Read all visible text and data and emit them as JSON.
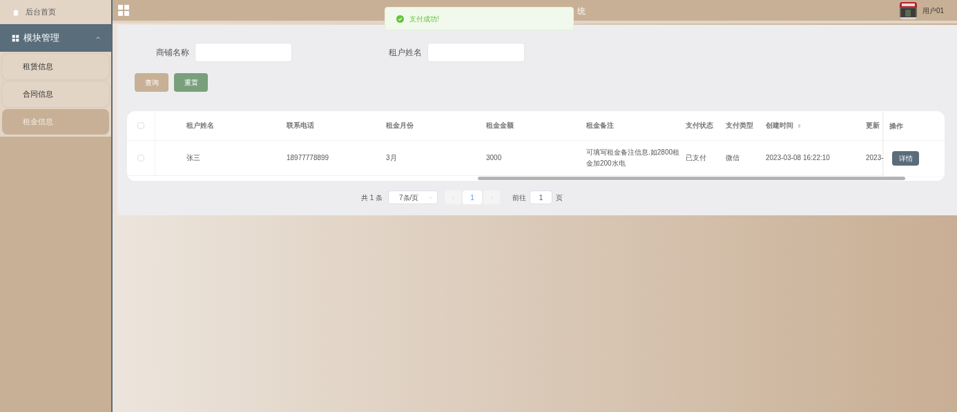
{
  "sidebar": {
    "home": {
      "label": "后台首页"
    },
    "group": {
      "label": "模块管理",
      "expanded": true,
      "items": [
        {
          "label": "租赁信息",
          "selected": false
        },
        {
          "label": "合同信息",
          "selected": false
        },
        {
          "label": "租金信息",
          "selected": true
        }
      ]
    }
  },
  "header": {
    "title": "统",
    "user": "用户01"
  },
  "toast": {
    "message": "支付成功!"
  },
  "filters": [
    {
      "label": "商铺名称"
    },
    {
      "label": "租户姓名"
    }
  ],
  "buttons": [
    {
      "label": "查询",
      "kind": "search"
    },
    {
      "label": "重置",
      "kind": "reset"
    }
  ],
  "table": {
    "columns": [
      {
        "label": "租户姓名",
        "sortable": false
      },
      {
        "label": "联系电话",
        "sortable": false
      },
      {
        "label": "租金月份",
        "sortable": false
      },
      {
        "label": "租金金额",
        "sortable": false
      },
      {
        "label": "租金备注",
        "sortable": false
      },
      {
        "label": "支付状态",
        "sortable": false
      },
      {
        "label": "支付类型",
        "sortable": false
      },
      {
        "label": "创建时间",
        "sortable": true
      },
      {
        "label": "更新",
        "sortable": false
      }
    ],
    "action_column": "操作",
    "all_checked": false,
    "rows": [
      {
        "checked": false,
        "cells": [
          "张三",
          "18977778899",
          "3月",
          "3000",
          "可填写租金备注信息.如2800租金加200水电",
          "已支付",
          "微信",
          "2023-03-08 16:22:10",
          "2023-"
        ],
        "action": "详情"
      }
    ]
  },
  "pagination": {
    "total": "共 1 条",
    "page_size": "7条/页",
    "pages": [
      {
        "label": "1",
        "selected": true
      }
    ],
    "goto_label": "前往",
    "goto_value": "1",
    "goto_suffix": "页"
  }
}
